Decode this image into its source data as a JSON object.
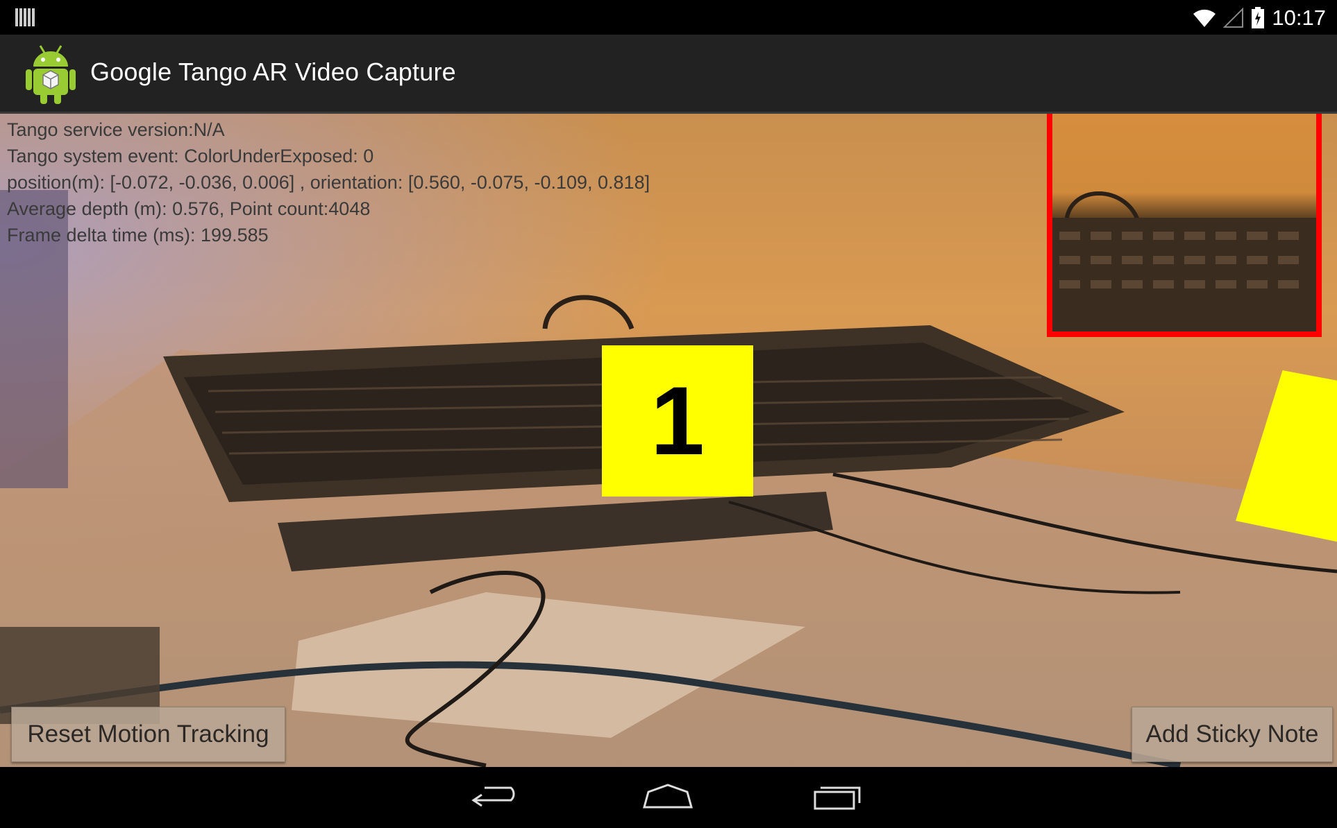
{
  "status_bar": {
    "time": "10:17",
    "icons": [
      "notification-bars-icon",
      "wifi-icon",
      "cell-signal-icon",
      "battery-charging-icon"
    ]
  },
  "action_bar": {
    "title": "Google Tango AR Video Capture",
    "icon": "android-robot-icon"
  },
  "info_overlay": {
    "service_version": "Tango service version:N/A",
    "system_event": "Tango system event: ColorUnderExposed: 0",
    "pose": "position(m): [-0.072, -0.036, 0.006] , orientation: [0.560, -0.075, -0.109, 0.818]",
    "depth": "Average depth (m): 0.576, Point count:4048",
    "frame_delta": "Frame delta time (ms): 199.585"
  },
  "sticky_notes": [
    {
      "label": "1",
      "color": "#ffff00"
    },
    {
      "label": "",
      "color": "#ffff00"
    }
  ],
  "buttons": {
    "reset": "Reset Motion Tracking",
    "add_note": "Add Sticky Note"
  },
  "preview": {
    "border_color": "#ff0000"
  },
  "nav_bar": {
    "icons": [
      "back-icon",
      "home-icon",
      "recents-icon"
    ]
  }
}
